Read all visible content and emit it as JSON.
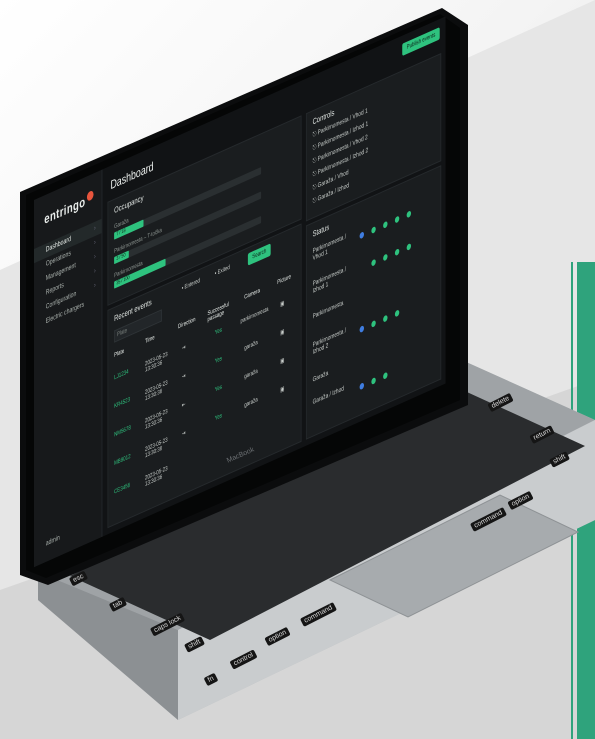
{
  "app": {
    "brand": "entringo",
    "page_title": "Dashboard",
    "publish_label": "Publish events"
  },
  "sidebar": {
    "items": [
      {
        "label": "Dashboard",
        "active": true
      },
      {
        "label": "Operations"
      },
      {
        "label": "Management"
      },
      {
        "label": "Reports"
      },
      {
        "label": "Configuration"
      },
      {
        "label": "Electric chargers"
      }
    ],
    "user": "admin"
  },
  "occupancy": {
    "title": "Occupancy",
    "rows": [
      {
        "label": "Garaža",
        "value": "7 / 18"
      },
      {
        "label": "Parkirnomesta – T-točka",
        "value": "3 / 50"
      },
      {
        "label": "Parkirnomesta",
        "value": "35 / 100"
      }
    ]
  },
  "controls": {
    "title": "Controls",
    "items": [
      "Parkirnomesta / Vhod 1",
      "Parkirnomesta / Izhod 1",
      "Parkirnomesta / Vhod 2",
      "Parkirnomesta / Izhod 2",
      "Garaža / Vhod",
      "Garaža / Izhod"
    ]
  },
  "status": {
    "title": "Status",
    "rows": [
      "Parkirnomesta / Vhod 1",
      "Parkirnomesta / Izhod 1",
      "Parkirnomesta",
      "Parkirnomesta / Izhod 2",
      "Garaža",
      "Garaža / Izhod"
    ]
  },
  "events": {
    "title": "Recent events",
    "filter_enter": "Entered",
    "filter_exit": "Exited",
    "search_label": "Search",
    "filter_placeholder": "Plate",
    "columns": [
      "Plate",
      "Time",
      "Direction",
      "Successful passage",
      "Camera",
      "Picture"
    ],
    "rows": [
      {
        "plate": "LJ1234",
        "time": "2023-05-23 13:30:36",
        "ok": "Yes",
        "camera": "parkirnomesta"
      },
      {
        "plate": "KR4523",
        "time": "2023-05-23 13:30:36",
        "ok": "Yes",
        "camera": "garaža"
      },
      {
        "plate": "NM5678",
        "time": "2023-05-23 13:30:36",
        "ok": "Yes",
        "camera": "garaža"
      },
      {
        "plate": "MB9012",
        "time": "2023-05-23 13:30:36",
        "ok": "Yes",
        "camera": "garaža"
      },
      {
        "plate": "CE3456",
        "time": "2023-05-23 13:30:36",
        "ok": "Yes",
        "camera": ""
      }
    ]
  },
  "device": {
    "model": "MacBook"
  },
  "keyboard": {
    "labels": [
      "esc",
      "tab",
      "caps lock",
      "shift",
      "control",
      "option",
      "command",
      "command",
      "option",
      "delete",
      "return",
      "shift",
      "fn"
    ]
  },
  "colors": {
    "accent": "#2ec27e",
    "brand_accent": "#e8553d",
    "side_bar_accent": "#2fa37c"
  }
}
